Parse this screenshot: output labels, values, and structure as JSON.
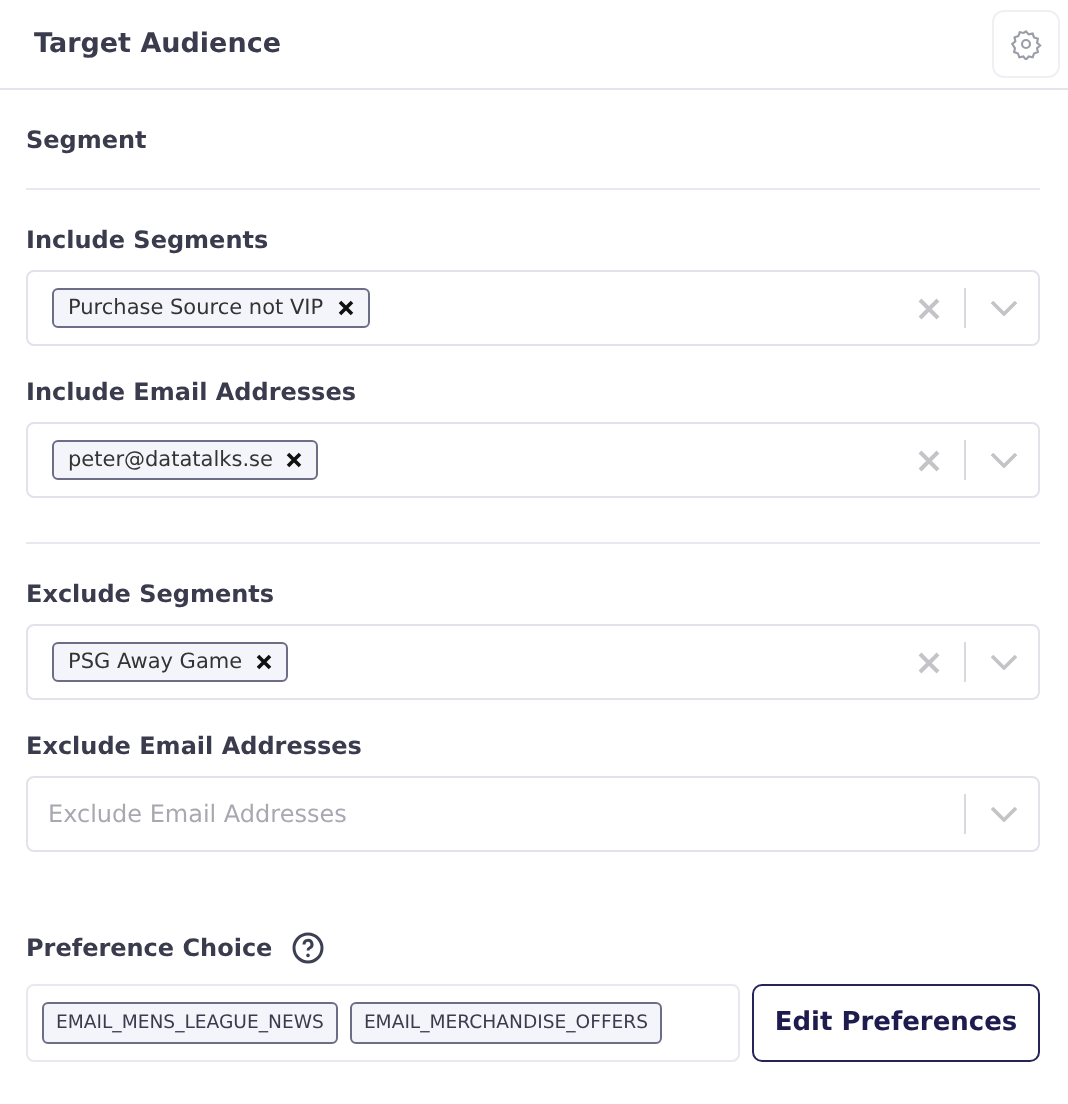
{
  "header": {
    "title": "Target Audience"
  },
  "segment_heading": "Segment",
  "groups": [
    [
      {
        "label": "Include Segments",
        "tags": [
          "Purchase Source not VIP"
        ]
      },
      {
        "label": "Include Email Addresses",
        "tags": [
          "peter@datatalks.se"
        ]
      }
    ],
    [
      {
        "label": "Exclude Segments",
        "tags": [
          "PSG Away Game"
        ]
      },
      {
        "label": "Exclude Email Addresses",
        "placeholder": "Exclude Email Addresses"
      }
    ]
  ],
  "preference": {
    "label": "Preference Choice",
    "tags": [
      "EMAIL_MENS_LEAGUE_NEWS",
      "EMAIL_MERCHANDISE_OFFERS"
    ],
    "button": "Edit Preferences"
  }
}
